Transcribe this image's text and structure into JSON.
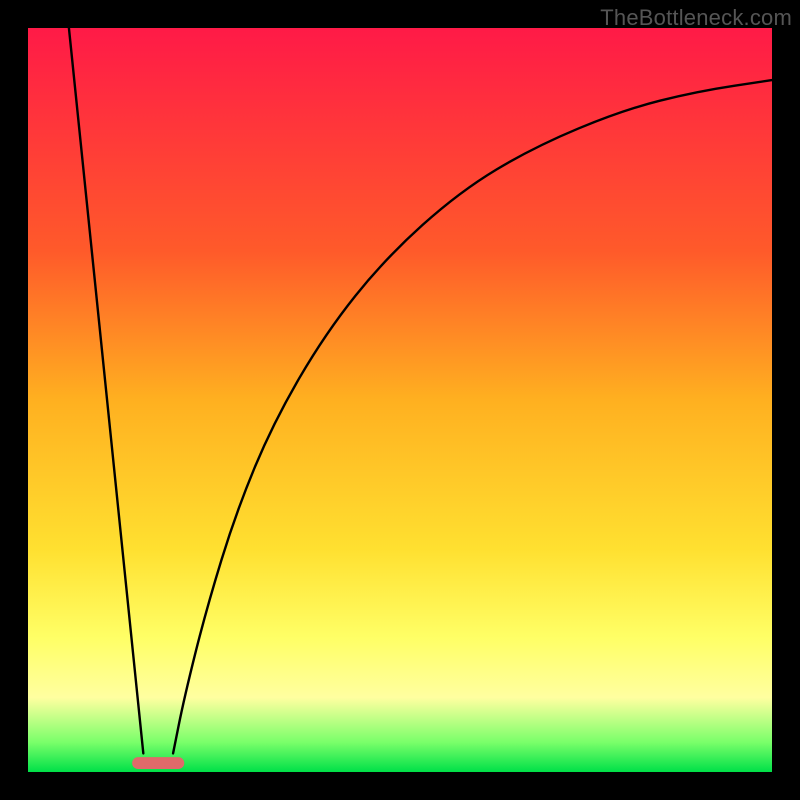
{
  "watermark": "TheBottleneck.com",
  "chart_data": {
    "type": "line",
    "title": "",
    "xlabel": "",
    "ylabel": "",
    "xlim": [
      0,
      100
    ],
    "ylim": [
      0,
      100
    ],
    "background_gradient": {
      "stops": [
        {
          "offset": 0.0,
          "color": "#ff1a47"
        },
        {
          "offset": 0.3,
          "color": "#ff5a2a"
        },
        {
          "offset": 0.5,
          "color": "#ffb020"
        },
        {
          "offset": 0.7,
          "color": "#ffe030"
        },
        {
          "offset": 0.82,
          "color": "#ffff66"
        },
        {
          "offset": 0.9,
          "color": "#ffffa0"
        },
        {
          "offset": 0.96,
          "color": "#7aff6a"
        },
        {
          "offset": 1.0,
          "color": "#00e048"
        }
      ]
    },
    "marker": {
      "x": 17.5,
      "y": 98.8,
      "width": 7,
      "height": 1.6,
      "color": "#e06a6a"
    },
    "series": [
      {
        "name": "left-line",
        "type": "line",
        "points": [
          {
            "x": 5.5,
            "y": 0
          },
          {
            "x": 15.5,
            "y": 97.5
          }
        ]
      },
      {
        "name": "right-curve",
        "type": "curve",
        "points": [
          {
            "x": 19.5,
            "y": 97.5
          },
          {
            "x": 21,
            "y": 90
          },
          {
            "x": 24,
            "y": 78
          },
          {
            "x": 28,
            "y": 65
          },
          {
            "x": 33,
            "y": 53
          },
          {
            "x": 40,
            "y": 41
          },
          {
            "x": 48,
            "y": 31
          },
          {
            "x": 58,
            "y": 22
          },
          {
            "x": 68,
            "y": 16
          },
          {
            "x": 80,
            "y": 11
          },
          {
            "x": 90,
            "y": 8.5
          },
          {
            "x": 100,
            "y": 7
          }
        ]
      }
    ]
  }
}
